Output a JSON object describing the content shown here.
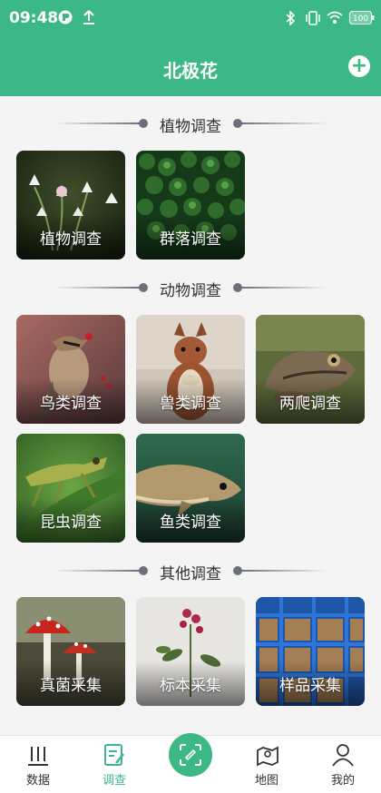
{
  "status_bar": {
    "time": "09:48",
    "battery": "100"
  },
  "header": {
    "title": "北极花",
    "add_icon": "plus-circle-icon"
  },
  "sections": [
    {
      "title": "植物调查",
      "cards": [
        {
          "label": "植物调查"
        },
        {
          "label": "群落调查"
        }
      ]
    },
    {
      "title": "动物调查",
      "cards": [
        {
          "label": "鸟类调查"
        },
        {
          "label": "兽类调查"
        },
        {
          "label": "两爬调查"
        },
        {
          "label": "昆虫调查"
        },
        {
          "label": "鱼类调查"
        }
      ]
    },
    {
      "title": "其他调查",
      "cards": [
        {
          "label": "真菌采集"
        },
        {
          "label": "标本采集"
        },
        {
          "label": "样品采集"
        }
      ]
    }
  ],
  "tabbar": {
    "tabs": [
      {
        "label": "数据"
      },
      {
        "label": "调查"
      },
      {
        "label": "地图"
      },
      {
        "label": "我的"
      }
    ],
    "active": "调查"
  },
  "colors": {
    "brand": "#3cb886",
    "background": "#f4f4f4"
  }
}
